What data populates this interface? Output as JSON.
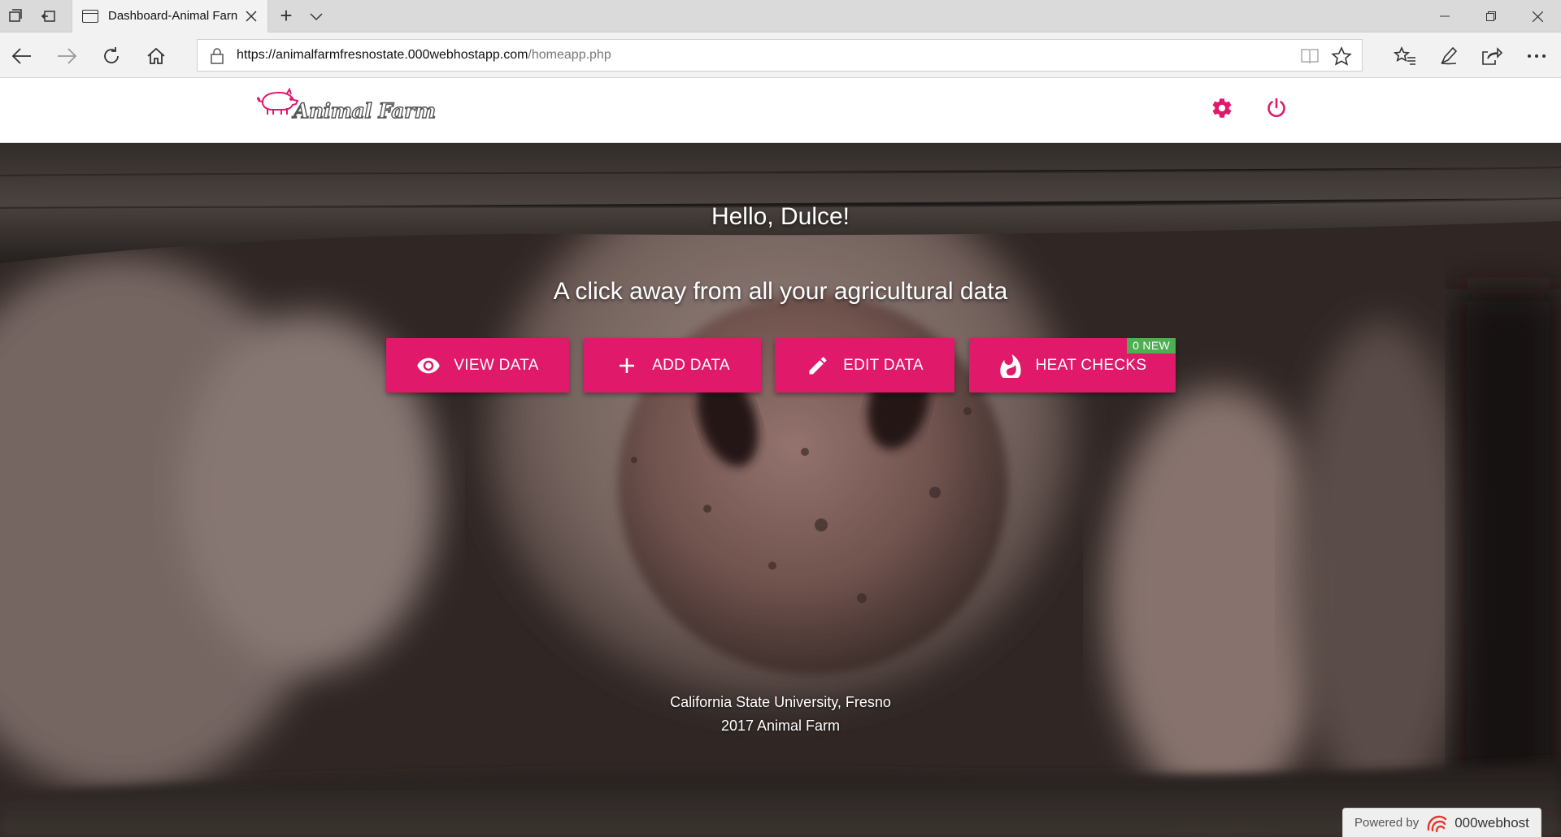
{
  "browser": {
    "tab_title": "Dashboard-Animal Farn",
    "url_host": "https://animalfarmfresnostate.000webhostapp.com",
    "url_path": "/homeapp.php"
  },
  "site": {
    "logo_text": "Animal Farm"
  },
  "hero": {
    "greeting": "Hello, Dulce!",
    "tagline": "A click away from all your agricultural data"
  },
  "actions": {
    "view_label": "VIEW DATA",
    "add_label": "ADD DATA",
    "edit_label": "EDIT DATA",
    "heat_label": "HEAT CHECKS",
    "heat_badge": "0 NEW"
  },
  "footer": {
    "line1": "California State University, Fresno",
    "line2": "2017 Animal Farm"
  },
  "hosting": {
    "powered_label": "Powered by",
    "brand": "000webhost"
  },
  "colors": {
    "accent": "#e0196b",
    "badge": "#4caf50"
  }
}
